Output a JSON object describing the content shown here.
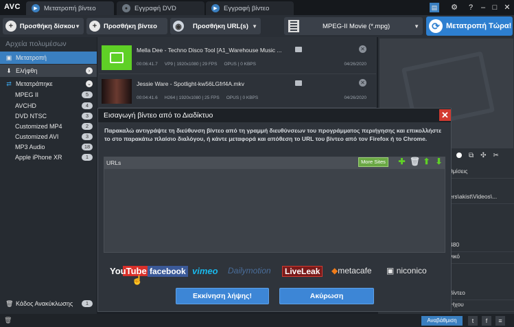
{
  "app": {
    "logo": "AVC"
  },
  "tabs": [
    {
      "label": "Μετατροπή βίντεο",
      "icon": "film-icon"
    },
    {
      "label": "Εγγραφή DVD",
      "icon": "disc-icon"
    },
    {
      "label": "Εγγραφή βίντεο",
      "icon": "record-icon"
    }
  ],
  "window_controls": {
    "minimize": "–",
    "maximize": "□",
    "close": "✕",
    "help": "?",
    "settings": "⚙"
  },
  "toolbar": {
    "add_disc": "Προσθήκη δίσκου CD",
    "add_video": "Προσθήκη βίντεο",
    "add_url": "Προσθήκη URL(s)",
    "format": "MPEG-II Movie (*.mpg)",
    "convert": "Μετατροπή Τώρα!"
  },
  "sidebar": {
    "title": "Αρχεία πολυμέσων",
    "main_items": [
      {
        "label": "Μετατροπή",
        "icon": "convert-icon"
      },
      {
        "label": "Ελήφθη",
        "icon": "download-icon"
      },
      {
        "label": "Μετατράπηκε",
        "icon": "converted-icon"
      }
    ],
    "formats": [
      {
        "label": "MPEG II",
        "count": "5"
      },
      {
        "label": "AVCHD",
        "count": "4"
      },
      {
        "label": "DVD NTSC",
        "count": "3"
      },
      {
        "label": "Customized MP4",
        "count": "2"
      },
      {
        "label": "Customized AVI",
        "count": "3"
      },
      {
        "label": "MP3 Audio",
        "count": "18"
      },
      {
        "label": "Apple iPhone XR",
        "count": "1"
      }
    ],
    "trash": {
      "label": "Κάδος Ανακύκλωσης",
      "count": "1"
    }
  },
  "files": [
    {
      "name": "Mella Dee - Techno Disco Tool [A1_Warehouse Music ...",
      "duration": "00:06:41.7",
      "video": "VP9 | 1920x1080 | 29 FPS",
      "audio": "OPUS | 0 KBPS",
      "date": "04/26/2020"
    },
    {
      "name": "Jessie Ware - Spotlight-kw56LGfrf4A.mkv",
      "duration": "00:04:41.6",
      "video": "H264 | 1920x1080 | 25 FPS",
      "audio": "OPUS | 0 KBPS",
      "date": "04/26/2020"
    }
  ],
  "right_panel": {
    "rows": [
      "θμίσεις",
      "ers\\akist\\Videos\\...",
      "480",
      "νικό",
      "βίντεο",
      "Ήχου"
    ]
  },
  "bottom": {
    "upgrade": "Αναβάθμιση"
  },
  "dialog": {
    "title": "Εισαγωγή βίντεο από το Διαδίκτυο",
    "instructions": "Παρακαλώ αντιγράψτε τη διεύθυνση βίντεο από τη γραμμή διευθύνσεων του προγράμματος περιήγησης και επικολλήστε το στο παρακάτω πλαίσιο διαλόγου, ή κάντε μεταφορά και απόθεση το URL του βίντεο από τον Firefox ή το Chrome.",
    "urls_label": "URLs",
    "more_sites": "More Sites",
    "sites": [
      "YouTube",
      "facebook",
      "vimeo",
      "Dailymotion",
      "LiveLeak",
      "metacafe",
      "niconico"
    ],
    "start_button": "Εκκίνηση λήψης!",
    "cancel_button": "Ακύρωση"
  }
}
